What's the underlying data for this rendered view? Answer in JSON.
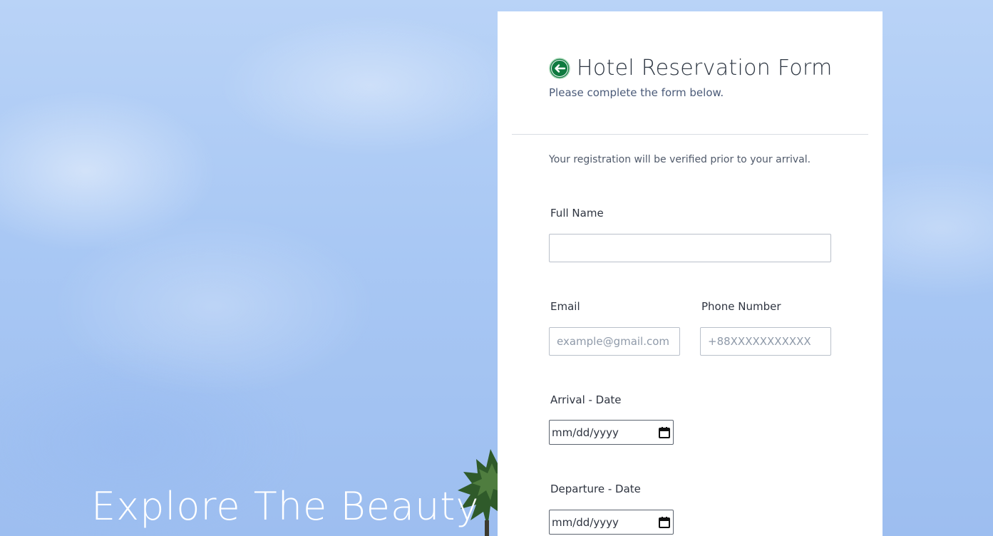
{
  "hero": {
    "title": "Explore The Beauty"
  },
  "form": {
    "title": "Hotel Reservation Form",
    "subtitle": "Please complete the form below.",
    "note": "Your registration will be verified prior to your arrival.",
    "fields": {
      "full_name": {
        "label": "Full Name",
        "value": "",
        "placeholder": ""
      },
      "email": {
        "label": "Email",
        "value": "",
        "placeholder": "example@gmail.com"
      },
      "phone": {
        "label": "Phone Number",
        "value": "",
        "placeholder": "+88XXXXXXXXXXX"
      },
      "arrival": {
        "label": "Arrival - Date",
        "display": "mm/dd/yyyy"
      },
      "departure": {
        "label": "Departure - Date",
        "display": "mm/dd/yyyy"
      }
    }
  },
  "icons": {
    "back": "arrow-left-circle-icon",
    "calendar": "calendar-icon",
    "tree": "palm-tree"
  },
  "colors": {
    "back_icon": "#0f7a3f",
    "card_background": "#ffffff",
    "sky": "#a9c8f4"
  }
}
